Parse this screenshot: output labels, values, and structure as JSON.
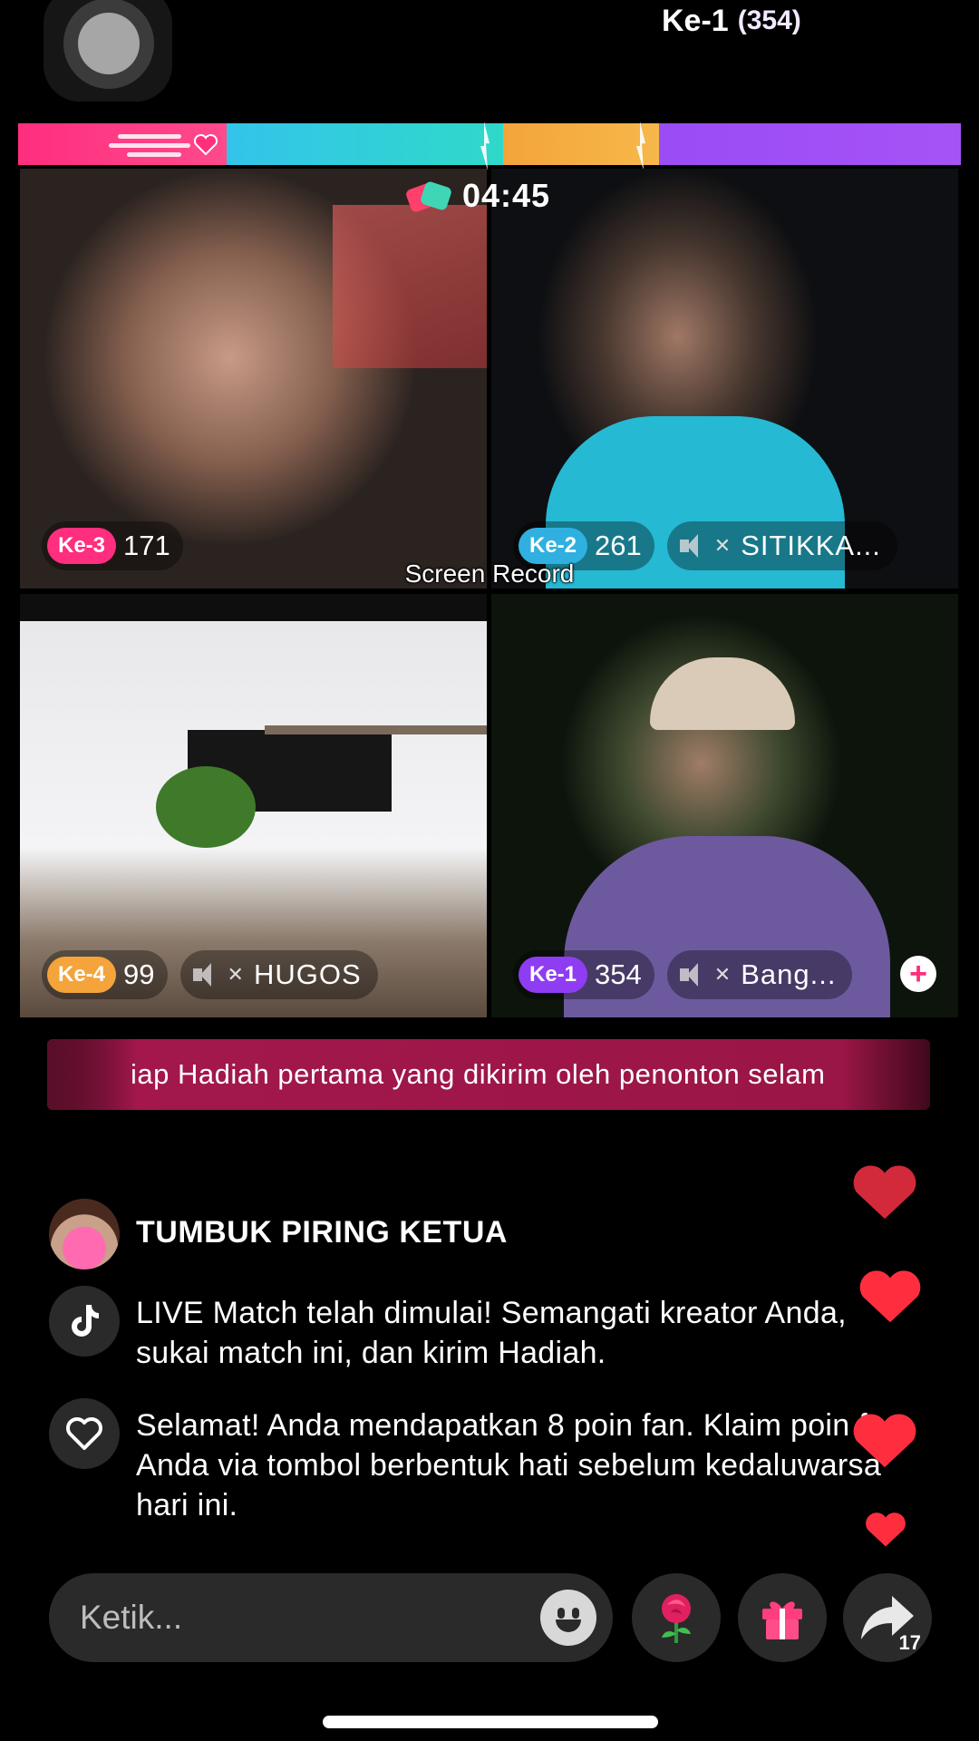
{
  "battle": {
    "leader_rank": "Ke-1",
    "leader_score": "(354)",
    "timer": "04:45",
    "colors": {
      "pink": "#ff2e7e",
      "blue": "#2fb0e0",
      "orange": "#f4a43a",
      "purple": "#8f3df2"
    }
  },
  "tiles": [
    {
      "rank": "Ke-3",
      "points": "171",
      "name": ""
    },
    {
      "rank": "Ke-2",
      "points": "261",
      "name": "SITIKKA..."
    },
    {
      "rank": "Ke-4",
      "points": "99",
      "name": "HUGOS"
    },
    {
      "rank": "Ke-1",
      "points": "354",
      "name": "Bang..."
    }
  ],
  "overlay": {
    "screen_record": "Screen Record"
  },
  "ticker": {
    "text": "iap Hadiah pertama yang dikirim oleh penonton selam"
  },
  "comments": [
    {
      "type": "user",
      "text": "TUMBUK PIRING KETUA",
      "icon": "user-avatar"
    },
    {
      "type": "system",
      "text": "LIVE Match telah dimulai! Semangati kreator Anda, sukai match ini, dan kirim Hadiah.",
      "icon": "tiktok-icon"
    },
    {
      "type": "system",
      "text": "Selamat! Anda mendapatkan 8 poin fan. Klaim poin fan Anda via tombol berbentuk hati sebelum kedaluwarsa hari ini.",
      "icon": "heart-outline-icon"
    }
  ],
  "input": {
    "placeholder": "Ketik..."
  },
  "share": {
    "count": "17"
  }
}
